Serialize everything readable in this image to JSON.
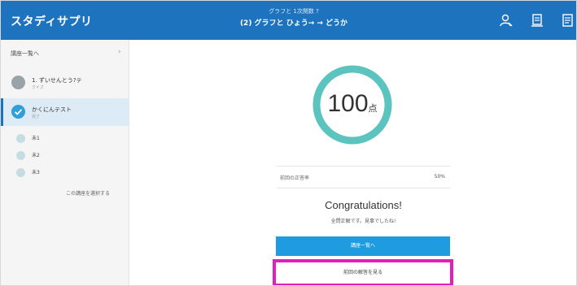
{
  "header": {
    "logo": "スタディサプリ",
    "subtitle": "グラフと 1次関数 ?",
    "title": "(2) グラフと ひょう→ → どうか",
    "icons": [
      "person-search-icon",
      "notebook-icon",
      "document-icon"
    ]
  },
  "sidebar": {
    "back_label": "講座一覧へ",
    "items": [
      {
        "label": "1. ずいせんとう?テ",
        "meta": "クイズ",
        "state": "grey"
      },
      {
        "label": "かくにんテスト",
        "meta": "完了",
        "state": "done"
      }
    ],
    "dot_items": [
      "未1",
      "未2",
      "未3"
    ],
    "next_label": "この講座を選択する"
  },
  "main": {
    "score_value": "100",
    "score_unit": "点",
    "rate_label": "前回の正答率",
    "rate_value": "50%",
    "congrats_title": "Congratulations!",
    "congrats_sub": "全問正解です。見事でしたね!",
    "primary_button": "講座一覧へ",
    "secondary_button": "前回の解答を見る"
  },
  "colors": {
    "header_bg": "#1e73be",
    "ring": "#5bc4bf",
    "primary_button": "#1f9be0",
    "highlight_border": "#e020b8"
  }
}
